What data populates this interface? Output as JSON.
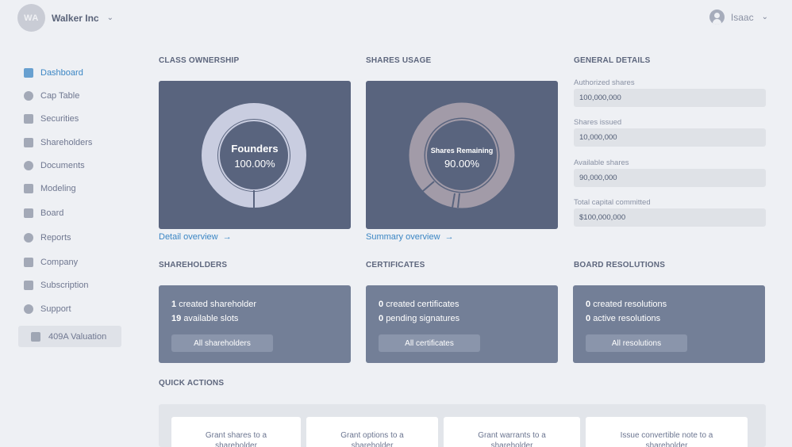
{
  "header": {
    "company_initials": "WA",
    "company_name": "Walker Inc",
    "user_name": "Isaac"
  },
  "sidebar": {
    "items": [
      {
        "label": "Dashboard",
        "icon": "dashboard-icon",
        "active": true
      },
      {
        "label": "Cap Table",
        "icon": "pie-chart-icon"
      },
      {
        "label": "Securities",
        "icon": "clipboard-icon"
      },
      {
        "label": "Shareholders",
        "icon": "person-icon"
      },
      {
        "label": "Documents",
        "icon": "folder-icon"
      },
      {
        "label": "Modeling",
        "icon": "lightbulb-icon"
      },
      {
        "label": "Board",
        "icon": "group-icon"
      },
      {
        "label": "Reports",
        "icon": "report-icon"
      },
      {
        "label": "Company",
        "icon": "gear-icon"
      },
      {
        "label": "Subscription",
        "icon": "dollar-icon"
      },
      {
        "label": "Support",
        "icon": "support-icon"
      }
    ],
    "valuation_label": "409A Valuation"
  },
  "class_ownership": {
    "title": "CLASS OWNERSHIP",
    "center_label": "Founders",
    "center_value": "100.00%",
    "link": "Detail overview",
    "ring_color": "#c9cde0"
  },
  "shares_usage": {
    "title": "SHARES USAGE",
    "center_label": "Shares Remaining",
    "center_value": "90.00%",
    "link": "Summary overview",
    "remaining_fraction": 0.9,
    "ring_color": "#a29ba8"
  },
  "general_details": {
    "title": "GENERAL DETAILS",
    "fields": [
      {
        "label": "Authorized shares",
        "value": "100,000,000"
      },
      {
        "label": "Shares issued",
        "value": "10,000,000"
      },
      {
        "label": "Available shares",
        "value": "90,000,000"
      },
      {
        "label": "Total capital committed",
        "value": "$100,000,000"
      }
    ]
  },
  "shareholders": {
    "title": "SHAREHOLDERS",
    "line1_count": "1",
    "line1_text": "created shareholder",
    "line2_count": "19",
    "line2_text": "available slots",
    "button": "All shareholders"
  },
  "certificates": {
    "title": "CERTIFICATES",
    "line1_count": "0",
    "line1_text": "created certificates",
    "line2_count": "0",
    "line2_text": "pending signatures",
    "button": "All certificates"
  },
  "board_resolutions": {
    "title": "BOARD RESOLUTIONS",
    "line1_count": "0",
    "line1_text": "created resolutions",
    "line2_count": "0",
    "line2_text": "active resolutions",
    "button": "All resolutions"
  },
  "quick_actions": {
    "title": "QUICK ACTIONS",
    "items": [
      {
        "line1": "Grant shares to a",
        "line2": "shareholder"
      },
      {
        "line1": "Grant options to a",
        "line2": "shareholder"
      },
      {
        "line1": "Grant warrants to a",
        "line2": "shareholder"
      },
      {
        "line1": "Issue convertible note to a",
        "line2": "shareholder"
      }
    ]
  }
}
